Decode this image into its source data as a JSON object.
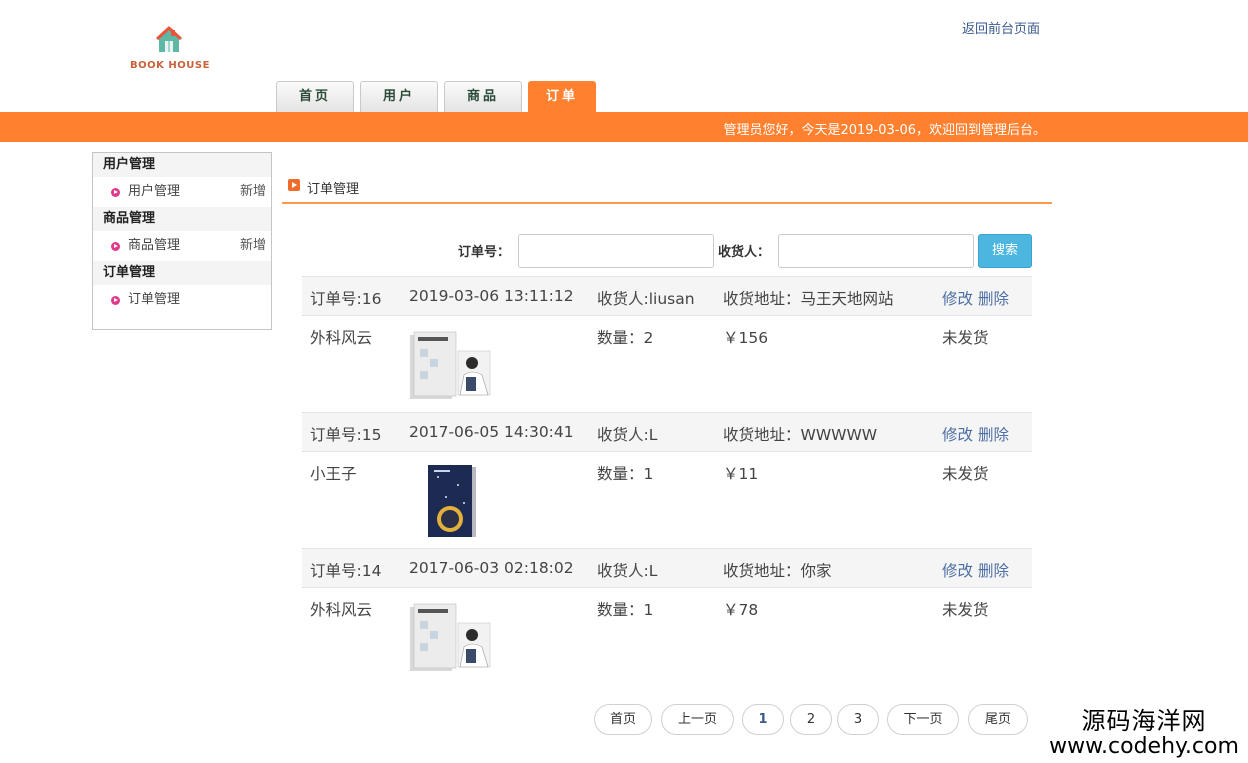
{
  "header": {
    "logo_text": "BOOK HOUSE",
    "back_link": "返回前台页面",
    "nav": [
      "首页",
      "用户",
      "商品",
      "订单"
    ],
    "active_tab": "订单",
    "welcome": "管理员您好，今天是2019-03-06，欢迎回到管理后台。"
  },
  "sidebar": {
    "groups": [
      {
        "title": "用户管理",
        "item": "用户管理",
        "add": "新增"
      },
      {
        "title": "商品管理",
        "item": "商品管理",
        "add": "新增"
      },
      {
        "title": "订单管理",
        "item": "订单管理",
        "add": ""
      }
    ]
  },
  "main": {
    "section_title": "订单管理",
    "search": {
      "order_label": "订单号：",
      "receiver_label": "收货人：",
      "order_value": "",
      "receiver_value": "",
      "button": "搜索"
    },
    "orders": [
      {
        "id": "订单号:16",
        "time": "2019-03-06 13:11:12",
        "receiver": "收货人:liusan",
        "address": "收货地址：马王天地网站",
        "edit": "修改",
        "delete": "删除",
        "book": "外科风云",
        "cover": "surgeon",
        "qty": "数量：2",
        "price": "￥156",
        "status": "未发货"
      },
      {
        "id": "订单号:15",
        "time": "2017-06-05 14:30:41",
        "receiver": "收货人:L",
        "address": "收货地址：WWWWW",
        "edit": "修改",
        "delete": "删除",
        "book": "小王子",
        "cover": "prince",
        "qty": "数量：1",
        "price": "￥11",
        "status": "未发货"
      },
      {
        "id": "订单号:14",
        "time": "2017-06-03 02:18:02",
        "receiver": "收货人:L",
        "address": "收货地址：你家",
        "edit": "修改",
        "delete": "删除",
        "book": "外科风云",
        "cover": "surgeon",
        "qty": "数量：1",
        "price": "￥78",
        "status": "未发货"
      }
    ],
    "pager": {
      "first": "首页",
      "prev": "上一页",
      "pages": [
        "1",
        "2",
        "3"
      ],
      "current": "1",
      "next": "下一页",
      "last": "尾页"
    }
  },
  "watermark": {
    "line1": "源码海洋网",
    "line2": "www.codehy.com"
  },
  "colors": {
    "accent": "#ff8130",
    "link": "#4c6fa6",
    "search_button": "#4cb6e0",
    "bullet": "#e2388b"
  }
}
